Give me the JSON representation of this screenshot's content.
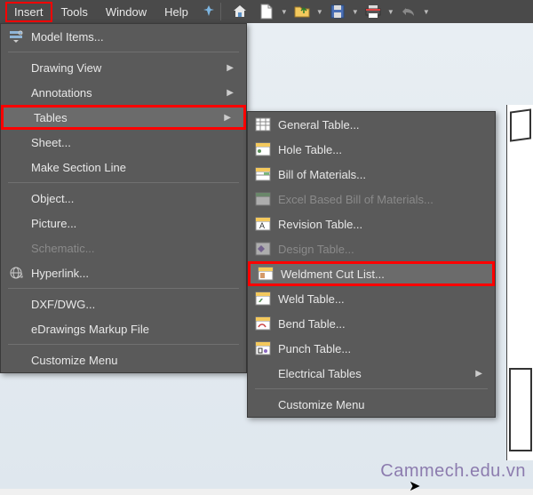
{
  "menubar": {
    "insert": "Insert",
    "tools": "Tools",
    "window": "Window",
    "help": "Help"
  },
  "menu1": {
    "model_items": "Model Items...",
    "drawing_view": "Drawing View",
    "annotations": "Annotations",
    "tables": "Tables",
    "sheet": "Sheet...",
    "make_section_line": "Make Section Line",
    "object": "Object...",
    "picture": "Picture...",
    "schematic": "Schematic...",
    "hyperlink": "Hyperlink...",
    "dxf_dwg": "DXF/DWG...",
    "edrawings": "eDrawings Markup File",
    "customize": "Customize Menu"
  },
  "menu2": {
    "general_table": "General Table...",
    "hole_table": "Hole Table...",
    "bom": "Bill of Materials...",
    "excel_bom": "Excel Based Bill of Materials...",
    "revision_table": "Revision Table...",
    "design_table": "Design Table...",
    "weldment_cut_list": "Weldment Cut List...",
    "weld_table": "Weld Table...",
    "bend_table": "Bend Table...",
    "punch_table": "Punch Table...",
    "electrical_tables": "Electrical Tables",
    "customize": "Customize Menu"
  },
  "watermark": "Cammech.edu.vn"
}
